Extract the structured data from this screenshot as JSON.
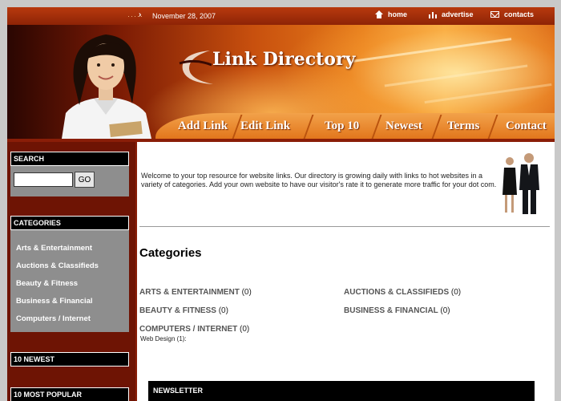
{
  "topbar": {
    "dots": "·····",
    "date": "November 28, 2007",
    "links": [
      {
        "label": "home",
        "icon": "home-icon"
      },
      {
        "label": "advertise",
        "icon": "chart-icon"
      },
      {
        "label": "contacts",
        "icon": "mail-icon"
      }
    ]
  },
  "header": {
    "site_title": "Link Directory",
    "nav": [
      "Add Link",
      "Edit Link",
      "Top 10",
      "Newest",
      "Terms",
      "Contact"
    ]
  },
  "sidebar": {
    "search_title": "SEARCH",
    "search_value": "",
    "go_label": "GO",
    "categories_title": "CATEGORIES",
    "categories": [
      "Arts & Entertainment",
      "Auctions & Classifieds",
      "Beauty & Fitness",
      "Business & Financial",
      "Computers / Internet"
    ],
    "newest_title": "10 NEWEST",
    "popular_title": "10 MOST POPULAR"
  },
  "main": {
    "welcome": "Welcome to your top resource for website links. Our directory is growing daily with links to hot websites in a variety of categories. Add your own website to have our visitor's rate it to generate more traffic for your dot com.",
    "categories_heading": "Categories",
    "cats": [
      {
        "name": "ARTS & ENTERTAINMENT",
        "count": "(0)"
      },
      {
        "name": "AUCTIONS & CLASSIFIEDS",
        "count": "(0)"
      },
      {
        "name": "BEAUTY & FITNESS",
        "count": "(0)"
      },
      {
        "name": "BUSINESS & FINANCIAL",
        "count": "(0)"
      },
      {
        "name": "COMPUTERS / INTERNET",
        "count": "(0)"
      }
    ],
    "subcat": "Web Design (1):",
    "newsletter_title": "NEWSLETTER"
  },
  "colors": {
    "header_dark": "#8a1e08",
    "nav_orange": "#e2761c",
    "panel_grey": "#8e8e8e"
  }
}
